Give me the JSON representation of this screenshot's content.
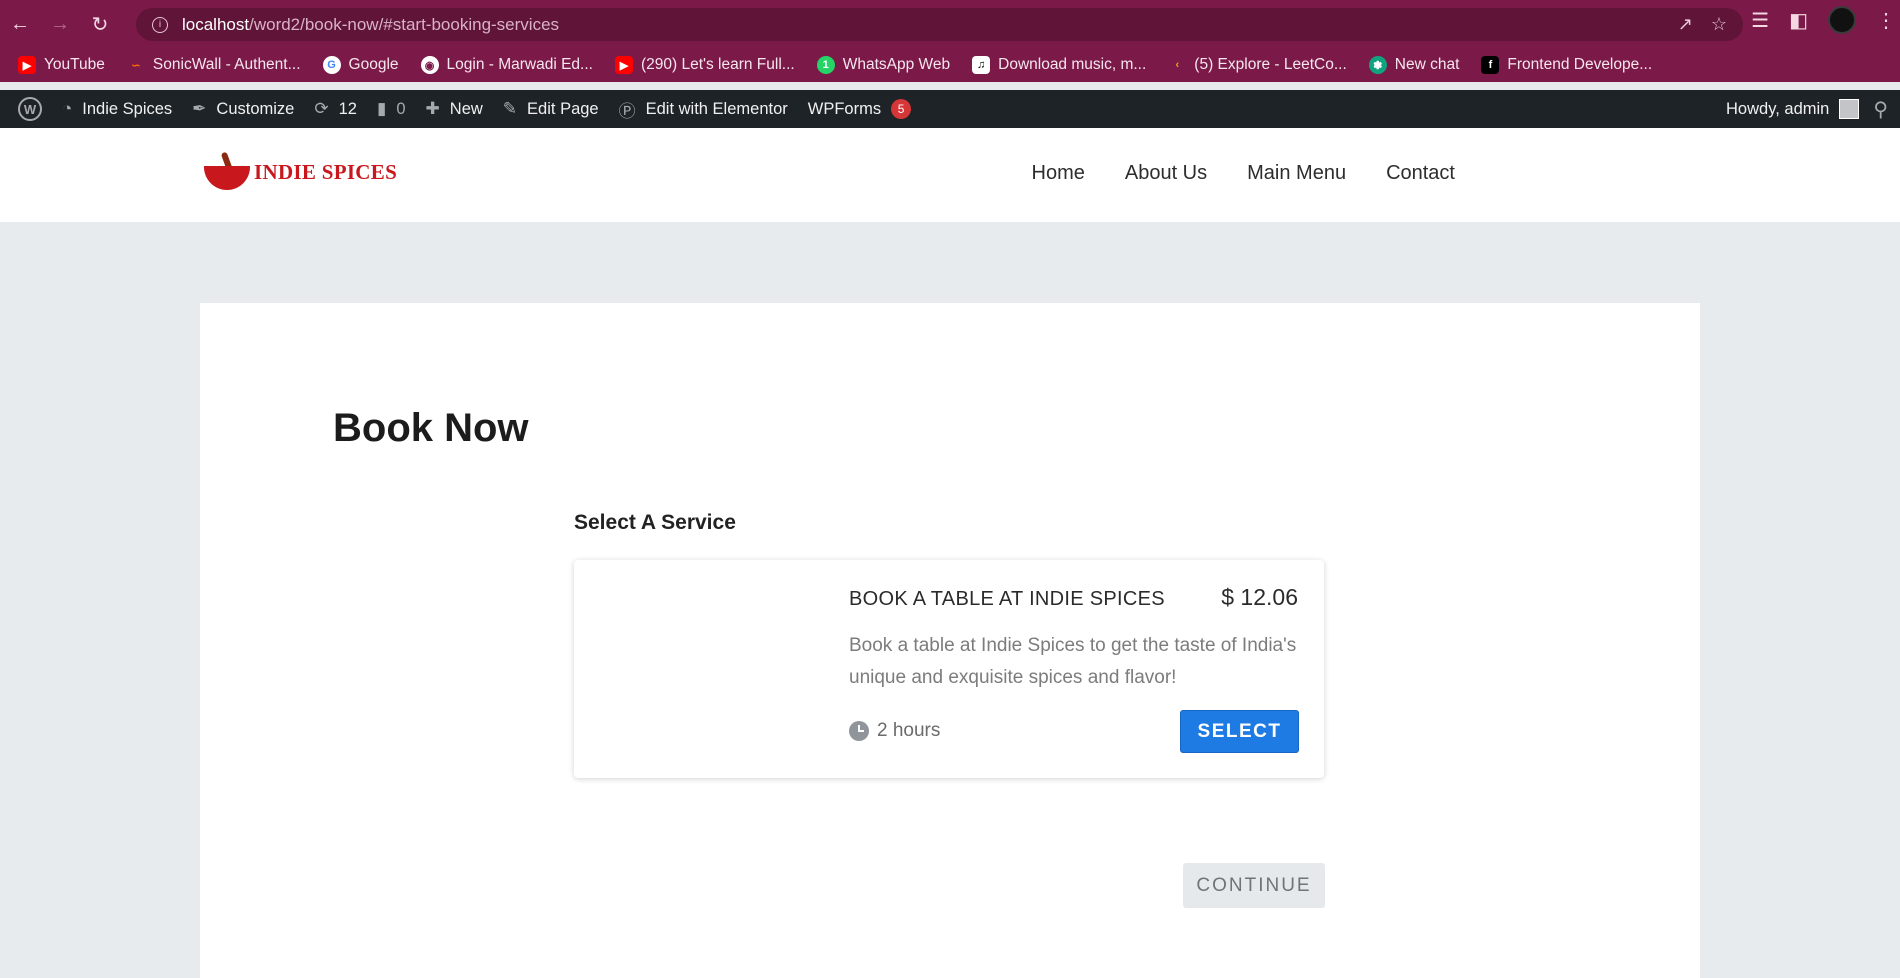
{
  "browser": {
    "url_host": "localhost",
    "url_path": "/word2/book-now/#start-booking-services",
    "bookmarks": [
      {
        "label": "YouTube",
        "icon": "youtube-icon",
        "color": "#ff0000"
      },
      {
        "label": "SonicWall - Authent...",
        "icon": "sonicwall-icon",
        "color": "#ff6a00"
      },
      {
        "label": "Google",
        "icon": "google-icon",
        "color": "#ffffff"
      },
      {
        "label": "Login - Marwadi Ed...",
        "icon": "globe-icon",
        "color": "#ffffff"
      },
      {
        "label": "(290) Let's learn Full...",
        "icon": "youtube-icon",
        "color": "#ff0000"
      },
      {
        "label": "WhatsApp Web",
        "icon": "whatsapp-icon",
        "color": "#25d366"
      },
      {
        "label": "Download music, m...",
        "icon": "music-icon",
        "color": "#ffffff"
      },
      {
        "label": "(5) Explore - LeetCo...",
        "icon": "leetcode-icon",
        "color": "#f89f1b"
      },
      {
        "label": "New chat",
        "icon": "openai-icon",
        "color": "#10a37f"
      },
      {
        "label": "Frontend Develope...",
        "icon": "frontend-icon",
        "color": "#000000"
      }
    ]
  },
  "adminbar": {
    "site_name": "Indie Spices",
    "customize": "Customize",
    "updates_count": "12",
    "comments_count": "0",
    "new_label": "New",
    "edit_page": "Edit Page",
    "edit_elementor": "Edit with Elementor",
    "wpforms": "WPForms",
    "wpforms_badge": "5",
    "howdy": "Howdy, admin"
  },
  "site": {
    "logo_text": "INDIE SPICES",
    "nav": [
      "Home",
      "About Us",
      "Main Menu",
      "Contact"
    ]
  },
  "main": {
    "page_title": "Book Now",
    "service_heading": "Select A Service",
    "service": {
      "name": "BOOK A TABLE AT INDIE SPICES",
      "price": "$ 12.06",
      "description": "Book a table at Indie Spices to get the taste of India's unique and exquisite spices and flavor!",
      "duration": "2 hours",
      "select_label": "SELECT"
    },
    "continue_label": "CONTINUE"
  }
}
